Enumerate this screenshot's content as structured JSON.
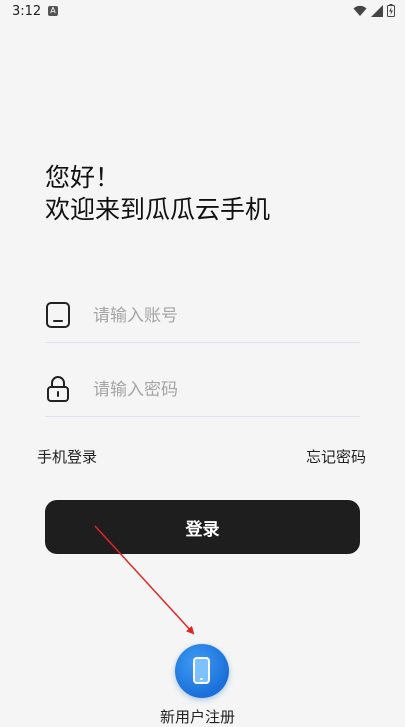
{
  "status_bar": {
    "time": "3:12",
    "notification_glyph": "A",
    "icons": [
      "wifi-icon",
      "signal-icon",
      "battery-charging-icon"
    ]
  },
  "greeting": {
    "line1": "您好！",
    "line2": "欢迎来到瓜瓜云手机"
  },
  "form": {
    "account_placeholder": "请输入账号",
    "account_icon": "phone-outline-icon",
    "password_placeholder": "请输入密码",
    "password_icon": "lock-icon"
  },
  "links": {
    "phone_login": "手机登录",
    "forgot_password": "忘记密码"
  },
  "login_button": "登录",
  "register": {
    "label": "新用户注册",
    "icon": "mobile-phone-icon"
  },
  "colors": {
    "background": "#f5f5f5",
    "button": "#1e1e1e",
    "register_blue": "#1a6fd8",
    "annotation_arrow": "#e02424"
  }
}
